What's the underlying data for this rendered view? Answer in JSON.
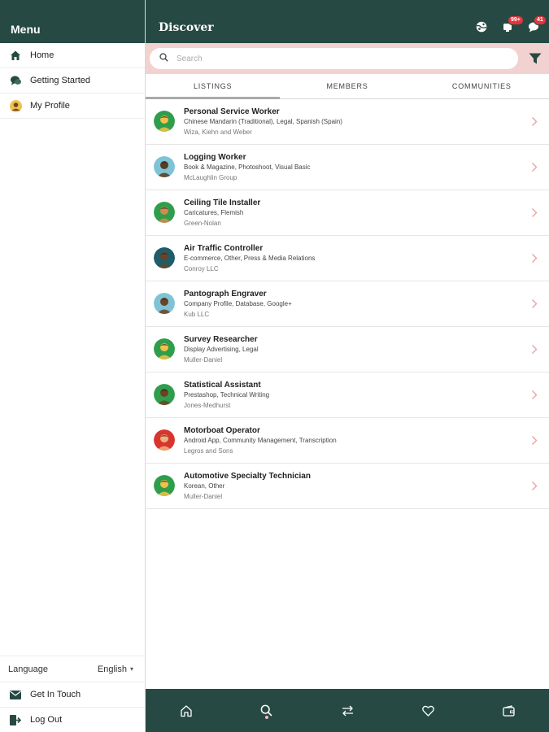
{
  "sidebar": {
    "title": "Menu",
    "items": [
      {
        "label": "Home",
        "icon": "home-icon"
      },
      {
        "label": "Getting Started",
        "icon": "chat-bubbles-icon"
      },
      {
        "label": "My Profile",
        "icon": "profile-avatar-icon"
      }
    ],
    "language_label": "Language",
    "language_value": "English",
    "bottom_items": [
      {
        "label": "Get In Touch",
        "icon": "mail-icon"
      },
      {
        "label": "Log Out",
        "icon": "logout-icon"
      }
    ]
  },
  "header": {
    "title": "Discover",
    "notification_badge": "99+",
    "messages_badge": "41"
  },
  "search": {
    "placeholder": "Search"
  },
  "tabs": [
    {
      "label": "LISTINGS",
      "active": true
    },
    {
      "label": "MEMBERS",
      "active": false
    },
    {
      "label": "COMMUNITIES",
      "active": false
    }
  ],
  "listings": [
    {
      "title": "Personal Service Worker",
      "tags": "Chinese Mandarin (Traditional), Legal, Spanish (Spain)",
      "company": "Wiza, Kiehn and Weber",
      "avatar_bg": "#2f9e4c",
      "skin": "#f0c24b"
    },
    {
      "title": "Logging Worker",
      "tags": "Book & Magazine, Photoshoot, Visual Basic",
      "company": "McLaughlin Group",
      "avatar_bg": "#7ec3d6",
      "skin": "#5a3b24"
    },
    {
      "title": "Ceiling Tile Installer",
      "tags": "Caricatures, Flemish",
      "company": "Green-Nolan",
      "avatar_bg": "#2f9e4c",
      "skin": "#d4894f"
    },
    {
      "title": "Air Traffic Controller",
      "tags": "E-commerce, Other, Press & Media Relations",
      "company": "Conroy LLC",
      "avatar_bg": "#1f5d6b",
      "skin": "#6a4327"
    },
    {
      "title": "Pantograph Engraver",
      "tags": "Company Profile, Database, Google+",
      "company": "Kub LLC",
      "avatar_bg": "#7ec3d6",
      "skin": "#6a4327"
    },
    {
      "title": "Survey Researcher",
      "tags": "Display Advertising, Legal",
      "company": "Muller-Daniel",
      "avatar_bg": "#2f9e4c",
      "skin": "#f0c24b"
    },
    {
      "title": "Statistical Assistant",
      "tags": "Prestashop, Technical Writing",
      "company": "Jones-Medhurst",
      "avatar_bg": "#2f9e4c",
      "skin": "#6a4327"
    },
    {
      "title": "Motorboat Operator",
      "tags": "Android App, Community Management, Transcription",
      "company": "Legros and Sons",
      "avatar_bg": "#d8352f",
      "skin": "#f0b27a"
    },
    {
      "title": "Automotive Specialty Technician",
      "tags": "Korean, Other",
      "company": "Muller-Daniel",
      "avatar_bg": "#2f9e4c",
      "skin": "#f0c24b"
    }
  ],
  "bottom_nav": [
    {
      "icon": "home-outline-icon",
      "active": false
    },
    {
      "icon": "search-icon",
      "active": true
    },
    {
      "icon": "exchange-arrows-icon",
      "active": false
    },
    {
      "icon": "heart-icon",
      "active": false
    },
    {
      "icon": "wallet-icon",
      "active": false
    }
  ],
  "colors": {
    "brand_dark": "#264a43",
    "search_band": "#f2d2d1",
    "badge_red": "#e8333b"
  }
}
